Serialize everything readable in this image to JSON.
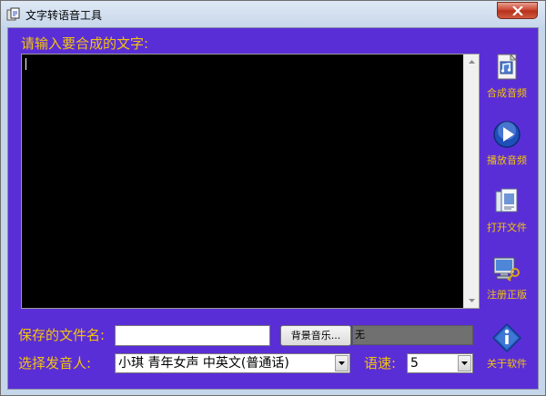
{
  "window": {
    "title": "文字转语音工具",
    "close_symbol": "×"
  },
  "main": {
    "prompt_label": "请输入要合成的文字:",
    "text_content": ""
  },
  "side_buttons": [
    {
      "label": "合成音频",
      "icon": "document-audio-icon"
    },
    {
      "label": "播放音频",
      "icon": "play-icon"
    },
    {
      "label": "打开文件",
      "icon": "open-files-icon"
    },
    {
      "label": "注册正版",
      "icon": "register-computer-icon"
    },
    {
      "label": "关于软件",
      "icon": "info-icon"
    }
  ],
  "form": {
    "filename_label": "保存的文件名:",
    "filename_value": "",
    "bgm_button_label": "背景音乐...",
    "bgm_value": "无",
    "voice_label": "选择发音人:",
    "voice_value": "小琪 青年女声 中英文(普通话)",
    "speed_label": "语速:",
    "speed_value": "5"
  },
  "colors": {
    "panel_background": "#5a2ed6",
    "label_yellow": "#f2c40c",
    "text_area": "#000000"
  }
}
